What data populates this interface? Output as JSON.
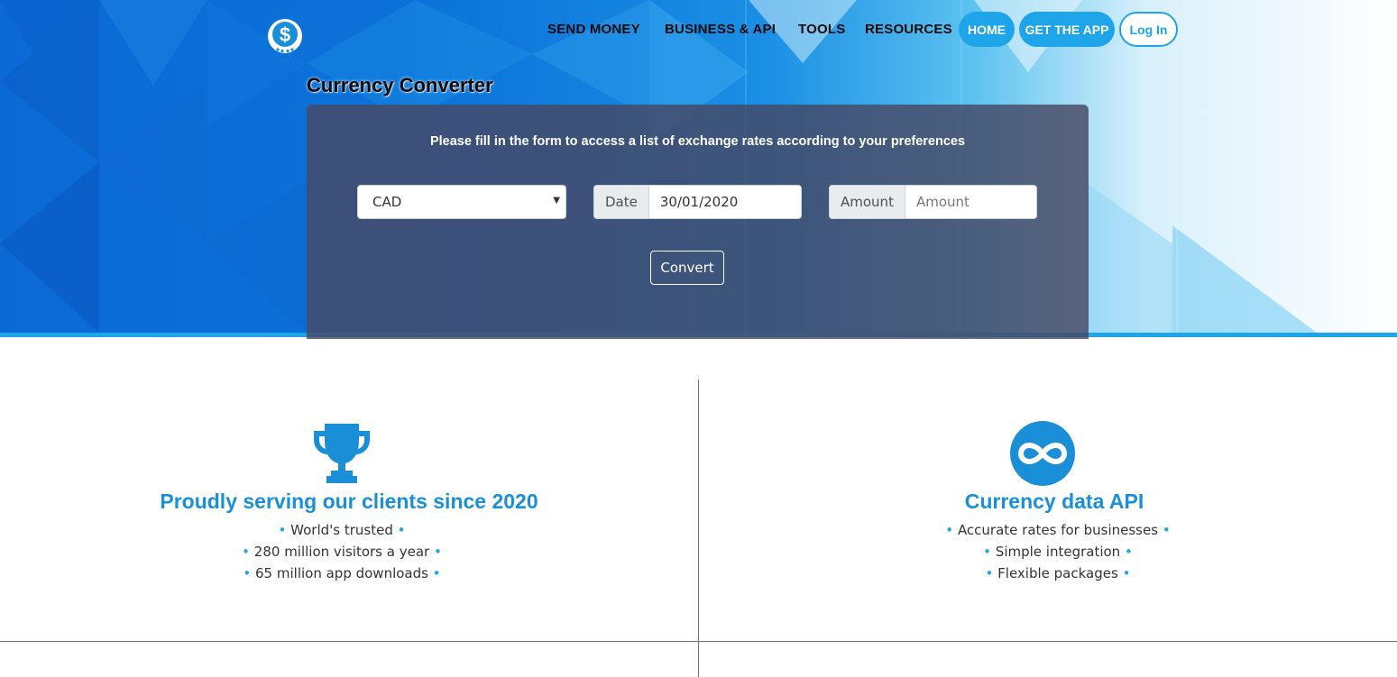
{
  "nav": {
    "links": [
      "SEND MONEY",
      "BUSINESS & API",
      "TOOLS",
      "RESOURCES"
    ],
    "home": "HOME",
    "get_app": "GET THE APP",
    "login": "Log In"
  },
  "converter": {
    "title": "Currency Converter",
    "heading": "Please fill in the form to access a list of exchange rates according to your preferences",
    "currency_selected": "CAD",
    "date_label": "Date",
    "date_value": "30/01/2020",
    "amount_label": "Amount",
    "amount_placeholder": "Amount",
    "convert_label": "Convert"
  },
  "features": [
    {
      "icon": "trophy-icon",
      "title": "Proudly serving our clients since 2020",
      "bullets": [
        "World's trusted",
        "280 million visitors a year",
        "65 million app downloads"
      ]
    },
    {
      "icon": "infinity-icon",
      "title": "Currency data API",
      "bullets": [
        "Accurate rates for businesses",
        "Simple integration",
        "Flexible packages"
      ]
    }
  ],
  "colors": {
    "accent": "#1ea4e9",
    "feature_title": "#1a8fd8"
  }
}
